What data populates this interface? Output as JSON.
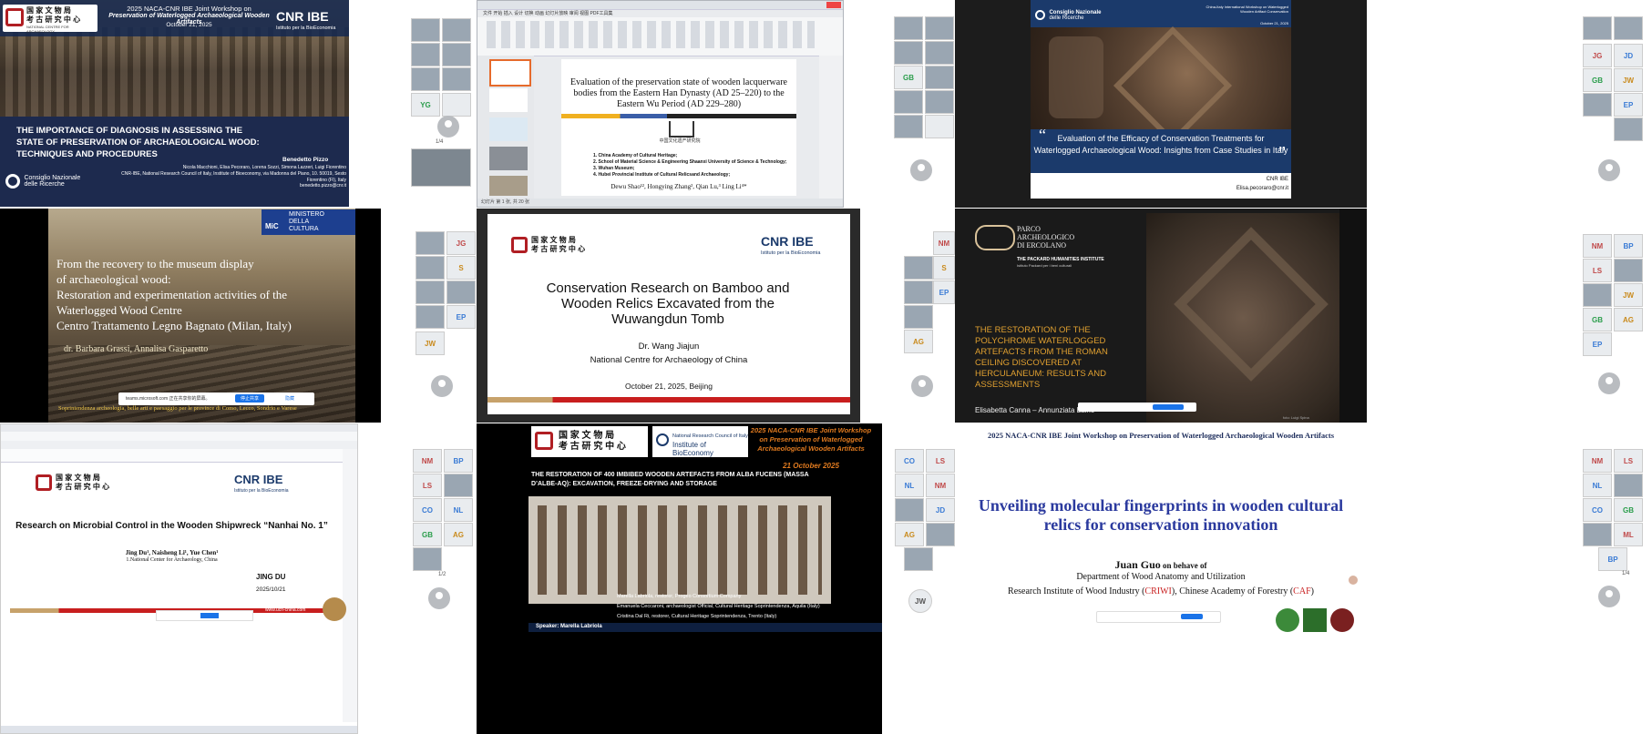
{
  "t1": {
    "org_cn": "国 家 文 物 局\n考 古 研 究 中 心",
    "org_en": "NATIONAL CENTRE FOR ARCHAEOLOGY",
    "workshop_line1": "2025 NACA-CNR IBE Joint Workshop on",
    "workshop_line2": "Preservation of Waterlogged Archaeological Wooden Artifacts",
    "date": "October 21, 2025",
    "logo": "CNR IBE",
    "logo_sub": "Istituto per la BioEconomia",
    "title": "THE IMPORTANCE OF DIAGNOSIS IN ASSESSING THE STATE OF PRESERVATION OF ARCHAEOLOGICAL WOOD: TECHNIQUES AND PROCEDURES",
    "speaker": "Benedetto Pizzo",
    "authors": "Nicola Macchioni, Elisa Pecoraro, Lorena Sozzi, Simona Lazzeri, Luigi Fiorentino",
    "affil": "CNR-IBE, National Research Council of Italy, Institute of Bioeconomy, via Madonna del Piano, 10. 50019, Sesto Fiorentino (FI), Italy",
    "email": "benedetto.pizzo@cnr.it",
    "cnr1": "Consiglio Nazionale",
    "cnr2": "delle Ricerche"
  },
  "t1side": {
    "initials": "YG",
    "page": "1/4"
  },
  "t2": {
    "title": "Evaluation of the preservation state of wooden lacquerware bodies from the Eastern Han Dynasty (AD 25–220) to the Eastern Wu Period (AD 229–280)",
    "aff1": "1. China Academy of Cultural Heritage;",
    "aff2": "2. School of Material Science & Engineering Shaanxi University of Science & Technology;",
    "aff3": "3. Wuhan Museum;",
    "aff4": "4. Hubei Provincial Institute of Cultural Relicsand Archaeology;",
    "authors": "Dewu Shao¹², Hongying Zhang², Qian Lu,³ Ling Li⁴*",
    "logo_cn": "中国文化遗产研究院",
    "menu": "文件   开始   插入   设计   切换   动画   幻灯片放映   审阅   视图   PDF工具集",
    "app": "WPS Office",
    "status": "幻灯片 第 1 张, 共 20 张"
  },
  "t3": {
    "workshop": "China-Italy International Workshop on Waterlogged Wooden Artifact Conservation",
    "date": "October 21, 2025",
    "cnr1": "Consiglio Nazionale",
    "cnr2": "delle Ricerche",
    "title": "Evaluation of the Efficacy of Conservation Treatments for Waterlogged Archaeological Wood: Insights from Case Studies in Italy",
    "org": "CNR IBE",
    "email": "Elisa.pecoraro@cnr.it"
  },
  "t4": {
    "title1": "From the recovery to the museum display",
    "title2": "of archaeological wood:",
    "title3": "Restoration and experimentation activities of the",
    "title4": "Waterlogged Wood Centre",
    "title5": "Centro Trattamento Legno Bagnato (Milan, Italy)",
    "authors": "dr. Barbara Grassi, Annalisa Gasparetto",
    "footer": "Soprintendenza archeologia, belle arti e paesaggio per le province di Como, Lecco, Sondrio e Varese",
    "mic": "MiC",
    "ministero": "MINISTERO\nDELLA\nCULTURA",
    "share_msg": "teams.microsoft.com 正在共享你的屏幕。",
    "stop_btn": "停止共享",
    "hide_btn": "隐藏"
  },
  "t5": {
    "org_cn": "国 家 文 物 局\n考 古 研 究 中 心",
    "logo": "CNR IBE",
    "logo_sub": "Istituto per la BioEconomia",
    "title": "Conservation Research on Bamboo and Wooden Relics Excavated from the Wuwangdun Tomb",
    "speaker": "Dr. Wang Jiajun",
    "affil": "National Centre for Archaeology of China",
    "date": "October  21,  2025,  Beijing"
  },
  "t6": {
    "parco1": "PARCO",
    "parco2": "ARCHEOLOGICO",
    "parco3": "DI ERCOLANO",
    "packard": "THE PACKARD HUMANITIES INSTITUTE",
    "packard_sub": "Istituto Packard per i beni culturali",
    "title": "THE RESTORATION OF THE POLYCHROME WATERLOGGED ARTEFACTS FROM THE ROMAN CEILING DISCOVERED AT HERCULANEUM: RESULTS AND ASSESSMENTS",
    "authors": "Elisabetta Canna – Annunziata Laino",
    "credit": "foto: Luigi Spina"
  },
  "t7": {
    "org_cn": "国 家 文 物 局\n考 古 研 究 中 心",
    "logo": "CNR IBE",
    "logo_sub": "Istituto per la BioEconomia",
    "title": "Research on Microbial Control in the Wooden Shipwreck  “Nanhai No. 1”",
    "authors": "Jing Du¹, Naisheng Li¹, Yue Chen¹",
    "affil": "1.National Center for Archaeology, China",
    "speaker": "JING DU",
    "date": "2025/10/21",
    "url": "www.ucn-china.com"
  },
  "t8": {
    "workshop": "2025 NACA-CNR IBE Joint Workshop on Preservation of Waterlogged Archaeological Wooden Artifacts",
    "date": "21 October 2025",
    "title": "THE RESTORATION OF 400 IMBIBED WOODEN ARTEFACTS FROM ALBA FUCENS (MASSA D’ALBE-AQ): EXCAVATION, FREEZE-DRYING AND STORAGE",
    "cnr_name": "National Research Council of Italy",
    "cnr_sub": "Institute of BioEconomy",
    "c1": "Marella Labriola, restorer, Progeo Consortium Company",
    "c2": "Emanuela Ceccaroni, archaeologist Official, Cultural Heritage Soprintendenza,  Aquila (Italy)",
    "c3": "Cristina Dal Ri, restorer, Cultural Heritage Soprintendenza,  Trento (Italy)",
    "speaker": "Speaker: Marella Labriola"
  },
  "t9": {
    "header": "2025 NACA-CNR IBE Joint Workshop on Preservation of Waterlogged Archaeological Wooden Artifacts",
    "title": "Unveiling molecular fingerprints in wooden cultural relics for conservation innovation",
    "speaker": "Juan Guo",
    "behalf": " on behave of",
    "dept": "Department of Wood Anatomy and Utilization",
    "inst_a": "Research Institute of Wood Industry (",
    "inst_b": "CRIWI",
    "inst_c": "), Chinese Academy of Forestry (",
    "inst_d": "CAF",
    "inst_e": ")"
  },
  "initials": {
    "c2": [
      "JG",
      "S",
      "EP",
      "JW"
    ],
    "c3": [
      "NM",
      "S",
      "EP",
      "AG"
    ],
    "c3b": [
      "CO",
      "LS",
      "NL",
      "NM",
      "JD",
      "AG",
      "JW"
    ],
    "c2b": [
      "NM",
      "BP",
      "LS",
      "CO",
      "NL",
      "GB",
      "AG"
    ],
    "c4": [
      "JG",
      "JW",
      "GB"
    ],
    "c4b": [
      "NM",
      "BP",
      "LS",
      "JW",
      "GB",
      "AG",
      "EP"
    ],
    "c4c": [
      "NM",
      "LS",
      "NL",
      "CO",
      "GB",
      "ML",
      "BP"
    ]
  },
  "pages": {
    "p": "1/4",
    "p2": "1/2",
    "p3": "1/3"
  }
}
